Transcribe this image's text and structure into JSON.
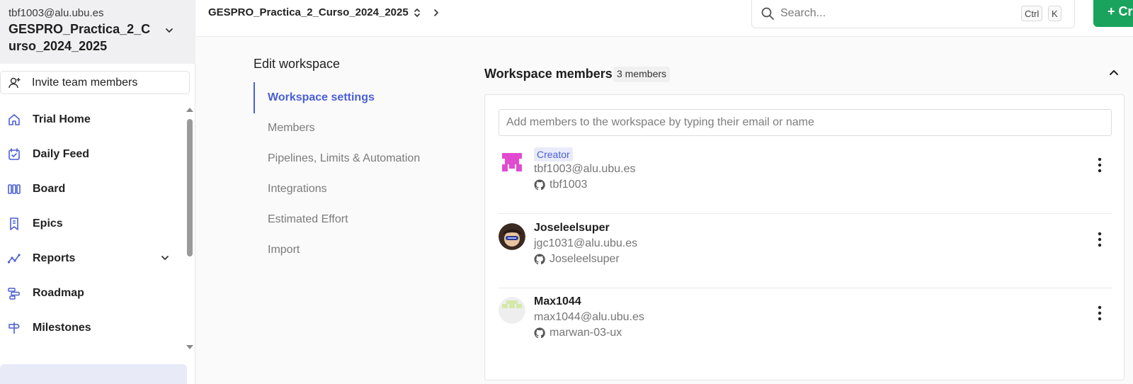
{
  "workspace": {
    "email": "tbf1003@alu.ubu.es",
    "name": "GESPRO_Practica_2_Curso_2024_2025"
  },
  "sidebar": {
    "invite_label": "Invite team members",
    "items": [
      {
        "label": "Trial Home",
        "icon": "home-icon"
      },
      {
        "label": "Daily Feed",
        "icon": "calendar-check-icon"
      },
      {
        "label": "Board",
        "icon": "board-columns-icon"
      },
      {
        "label": "Epics",
        "icon": "epic-bookmark-icon"
      },
      {
        "label": "Reports",
        "icon": "reports-chart-icon"
      },
      {
        "label": "Roadmap",
        "icon": "roadmap-icon"
      },
      {
        "label": "Milestones",
        "icon": "milestone-signpost-icon"
      }
    ]
  },
  "topbar": {
    "breadcrumb": "GESPRO_Practica_2_Curso_2024_2025",
    "search_placeholder": "Search...",
    "shortcut_keys": [
      "Ctrl",
      "K"
    ],
    "create_label": "+ Cr"
  },
  "settings": {
    "title": "Edit workspace",
    "menu": [
      "Workspace settings",
      "Members",
      "Pipelines, Limits & Automation",
      "Integrations",
      "Estimated Effort",
      "Import"
    ],
    "active_index": 0
  },
  "members_panel": {
    "title": "Workspace members",
    "count_label": "3 members",
    "add_placeholder": "Add members to the workspace by typing their email or name",
    "members": [
      {
        "name": "",
        "badge": "Creator",
        "email": "tbf1003@alu.ubu.es",
        "github": "tbf1003"
      },
      {
        "name": "Joseleelsuper",
        "badge": "",
        "email": "jgc1031@alu.ubu.es",
        "github": "Joseleelsuper"
      },
      {
        "name": "Max1044",
        "badge": "",
        "email": "max1044@alu.ubu.es",
        "github": "marwan-03-ux"
      }
    ]
  },
  "colors": {
    "accent": "#4a5fd6",
    "create_green": "#1aa35c",
    "sidebar_header_bg": "#f0f0f2"
  }
}
